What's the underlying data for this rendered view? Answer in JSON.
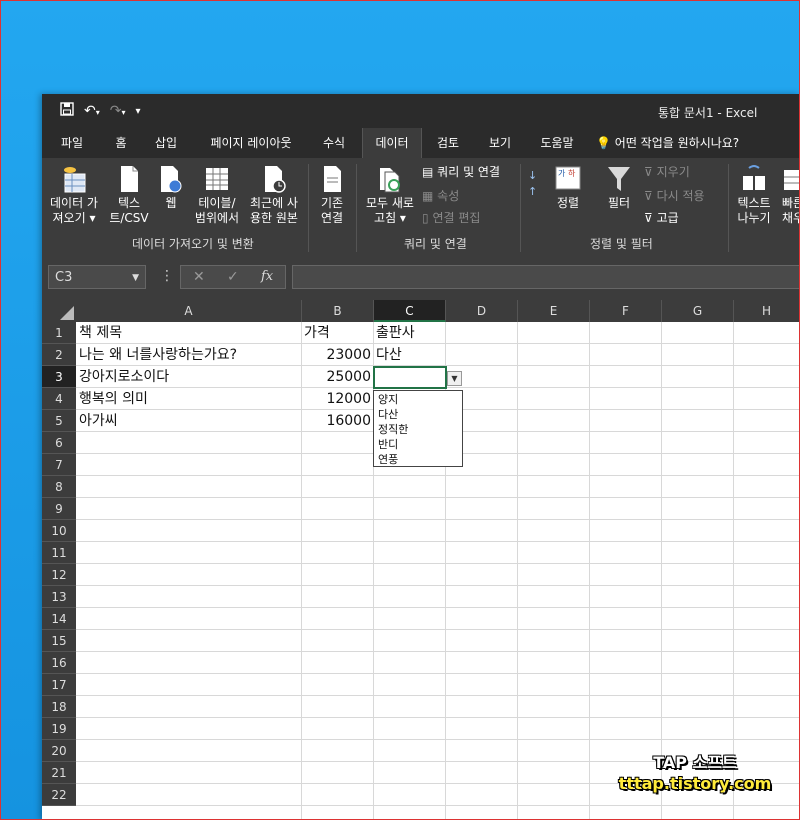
{
  "window": {
    "title": "통합 문서1 - Excel"
  },
  "qat": {
    "save_icon": "save-icon",
    "undo_icon": "undo-icon",
    "redo_icon": "redo-icon",
    "customize_icon": "customize-icon"
  },
  "tabs": [
    {
      "label": "파일"
    },
    {
      "label": "홈"
    },
    {
      "label": "삽입"
    },
    {
      "label": "페이지 레이아웃"
    },
    {
      "label": "수식"
    },
    {
      "label": "데이터"
    },
    {
      "label": "검토"
    },
    {
      "label": "보기"
    },
    {
      "label": "도움말"
    }
  ],
  "tellme": {
    "label": "어떤 작업을 원하시나요?"
  },
  "ribbon": {
    "get_data": "데이터 가\n져오기 ▾",
    "text_csv": "텍스\n트/CSV",
    "web": "웹",
    "table_range": "테이블/\n범위에서",
    "recent_sources": "최근에 사\n용한 원본",
    "existing_conn": "기존\n연결",
    "group1_title": "데이터 가져오기 및 변환",
    "refresh_all": "모두 새로\n고침 ▾",
    "queries_conn": "쿼리 및 연결",
    "properties": "속성",
    "edit_links": "연결 편집",
    "group2_title": "쿼리 및 연결",
    "sort": "정렬",
    "filter": "필터",
    "clear": "지우기",
    "reapply": "다시 적용",
    "advanced": "고급",
    "group3_title": "정렬 및 필터",
    "text_to_columns": "텍스트\n나누기",
    "flash_fill": "빠른\n채우"
  },
  "formula_bar": {
    "name_box": "C3",
    "fx": "fx",
    "cancel": "✕",
    "enter": "✓"
  },
  "columns": [
    "A",
    "B",
    "C",
    "D",
    "E",
    "F",
    "G",
    "H"
  ],
  "rows": [
    "1",
    "2",
    "3",
    "4",
    "5",
    "6",
    "7",
    "8",
    "9",
    "10",
    "11",
    "12",
    "13",
    "14",
    "15",
    "16",
    "17",
    "18",
    "19",
    "20",
    "21",
    "22"
  ],
  "cells": {
    "A1": "책 제목",
    "B1": "가격",
    "C1": "출판사",
    "A2": "나는 왜 너를사랑하는가요?",
    "B2": "23000",
    "C2": "다산",
    "A3": "강아지로소이다",
    "B3": "25000",
    "A4": "행복의 의미",
    "B4": "12000",
    "A5": "아가씨",
    "B5": "16000"
  },
  "dropdown": {
    "options": [
      "양지",
      "다산",
      "정직한",
      "반디",
      "연풍"
    ]
  },
  "watermark": {
    "line1": "TAP 소프트",
    "line2": "tttap.tistory.com"
  },
  "colors": {
    "excel_green": "#217346",
    "dark_bg": "#2b2b2b",
    "ribbon_bg": "#3c3c3c"
  }
}
